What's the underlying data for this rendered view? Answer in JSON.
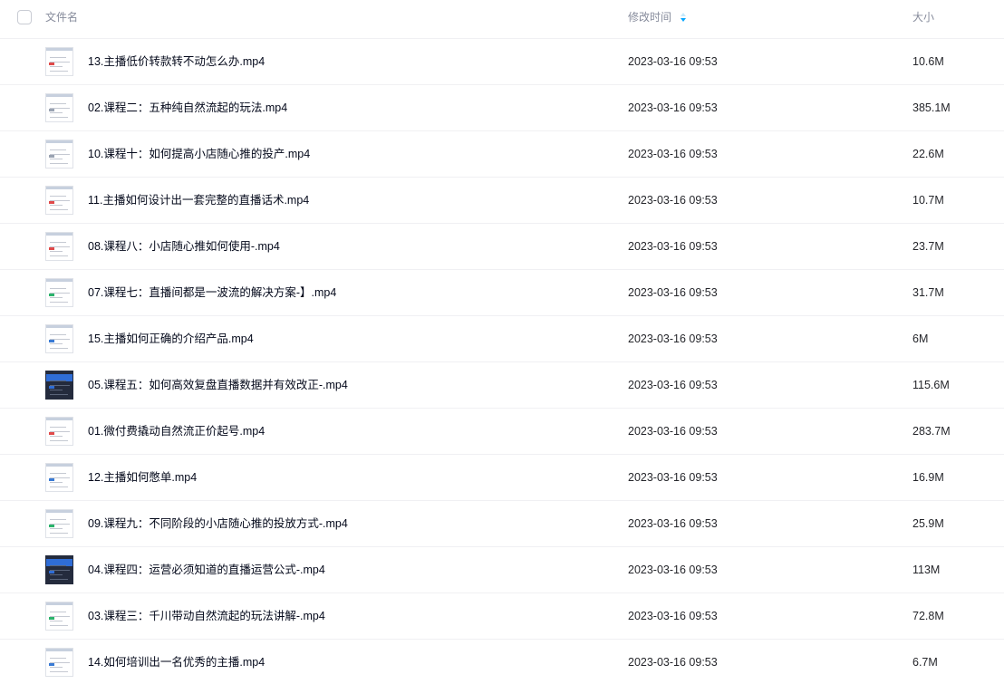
{
  "header": {
    "name_label": "文件名",
    "mtime_label": "修改时间",
    "size_label": "大小",
    "sort_icon": "sort-icon"
  },
  "colors": {
    "accent": "#06a7ff",
    "header_text": "#878c9c",
    "divider": "#f0f0f3"
  },
  "files": [
    {
      "name": "13.主播低价转款转不动怎么办.mp4",
      "mtime": "2023-03-16 09:53",
      "size": "10.6M",
      "thumb": "light",
      "accent": "#e04a4a"
    },
    {
      "name": "02.课程二：五种纯自然流起的玩法.mp4",
      "mtime": "2023-03-16 09:53",
      "size": "385.1M",
      "thumb": "light",
      "accent": "#9aa3b2"
    },
    {
      "name": "10.课程十：如何提高小店随心推的投产.mp4",
      "mtime": "2023-03-16 09:53",
      "size": "22.6M",
      "thumb": "light",
      "accent": "#9aa3b2"
    },
    {
      "name": "11.主播如何设计出一套完整的直播话术.mp4",
      "mtime": "2023-03-16 09:53",
      "size": "10.7M",
      "thumb": "light",
      "accent": "#e04a4a"
    },
    {
      "name": "08.课程八：小店随心推如何使用-.mp4",
      "mtime": "2023-03-16 09:53",
      "size": "23.7M",
      "thumb": "light",
      "accent": "#e04a4a"
    },
    {
      "name": "07.课程七：直播间都是一波流的解决方案-】.mp4",
      "mtime": "2023-03-16 09:53",
      "size": "31.7M",
      "thumb": "light",
      "accent": "#2bb36b"
    },
    {
      "name": "15.主播如何正确的介绍产品.mp4",
      "mtime": "2023-03-16 09:53",
      "size": "6M",
      "thumb": "light",
      "accent": "#3a7bd5"
    },
    {
      "name": "05.课程五：如何高效复盘直播数据并有效改正-.mp4",
      "mtime": "2023-03-16 09:53",
      "size": "115.6M",
      "thumb": "dark",
      "accent": "#2f6dd6"
    },
    {
      "name": "01.微付费撬动自然流正价起号.mp4",
      "mtime": "2023-03-16 09:53",
      "size": "283.7M",
      "thumb": "light",
      "accent": "#e04a4a"
    },
    {
      "name": "12.主播如何憋单.mp4",
      "mtime": "2023-03-16 09:53",
      "size": "16.9M",
      "thumb": "light",
      "accent": "#3a7bd5"
    },
    {
      "name": "09.课程九：不同阶段的小店随心推的投放方式-.mp4",
      "mtime": "2023-03-16 09:53",
      "size": "25.9M",
      "thumb": "light",
      "accent": "#2bb36b"
    },
    {
      "name": "04.课程四：运营必须知道的直播运营公式-.mp4",
      "mtime": "2023-03-16 09:53",
      "size": "113M",
      "thumb": "dark",
      "accent": "#2f6dd6"
    },
    {
      "name": "03.课程三：千川带动自然流起的玩法讲解-.mp4",
      "mtime": "2023-03-16 09:53",
      "size": "72.8M",
      "thumb": "light",
      "accent": "#2bb36b"
    },
    {
      "name": "14.如何培训出一名优秀的主播.mp4",
      "mtime": "2023-03-16 09:53",
      "size": "6.7M",
      "thumb": "light",
      "accent": "#3a7bd5"
    }
  ]
}
